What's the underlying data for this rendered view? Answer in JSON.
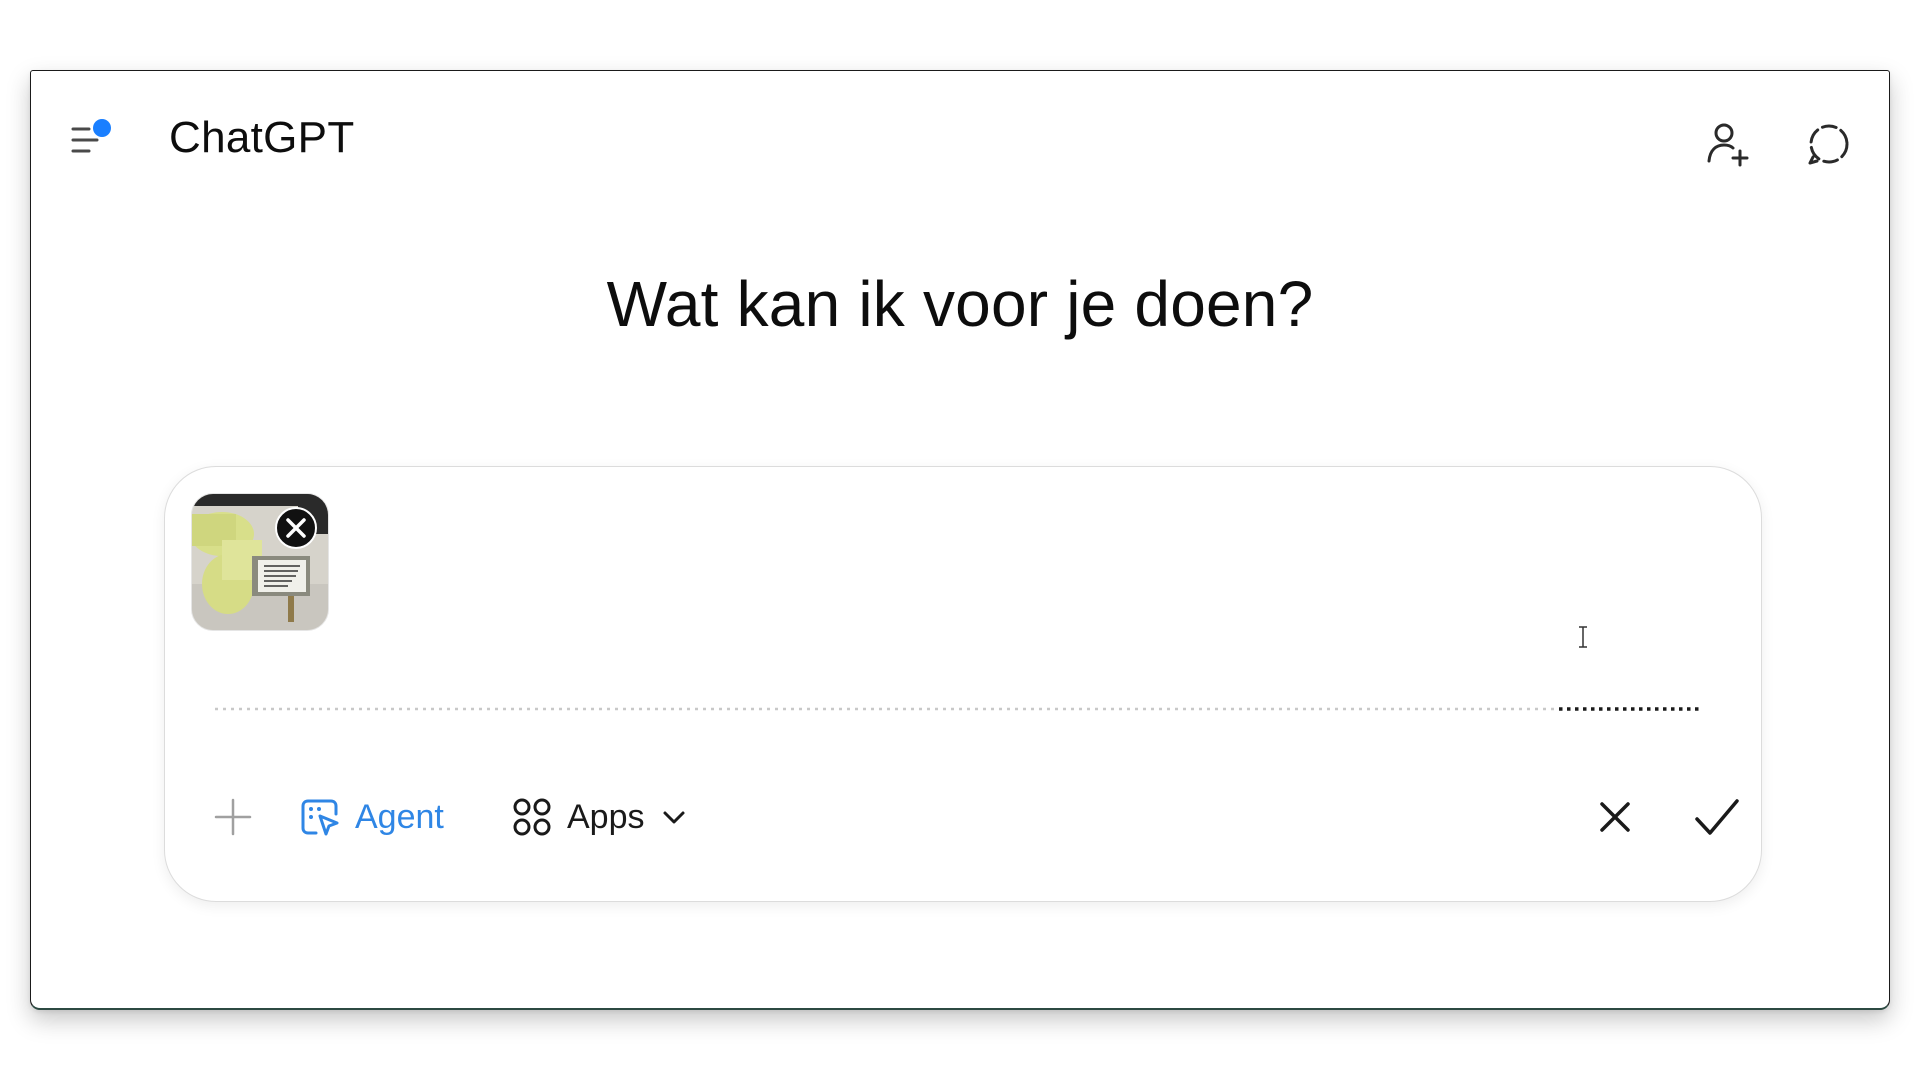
{
  "header": {
    "title": "ChatGPT",
    "menu_icon": "sidebar-menu-icon",
    "notification_dot_color": "#1a7fff",
    "invite_icon": "add-person-icon",
    "temporary_chat_icon": "temporary-chat-icon"
  },
  "main": {
    "headline": "Wat kan ik voor je doen?"
  },
  "composer": {
    "attachment": {
      "type": "image-thumbnail",
      "remove_icon": "close-icon"
    },
    "toolbar": {
      "add_icon": "plus-icon",
      "agent_label": "Agent",
      "agent_icon": "agent-cursor-icon",
      "agent_color": "#2f86e5",
      "apps_label": "Apps",
      "apps_icon": "apps-grid-icon",
      "apps_dropdown_icon": "chevron-down-icon",
      "cancel_icon": "close-icon",
      "confirm_icon": "checkmark-icon"
    }
  }
}
